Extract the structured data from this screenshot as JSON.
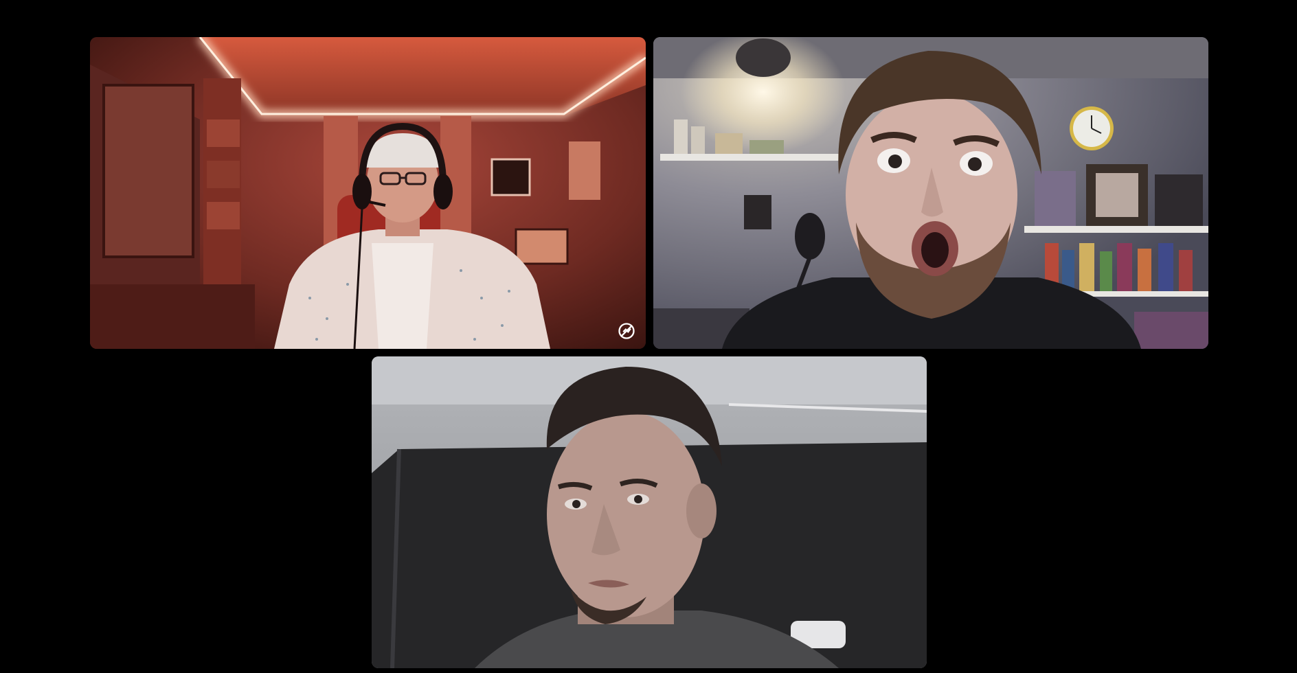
{
  "call": {
    "participants": [
      {
        "id": "participant-1",
        "video_state": "on",
        "muted": true,
        "indicator_icon": "mic-muted-icon",
        "scene_tint": "#c2412e"
      },
      {
        "id": "participant-2",
        "video_state": "on",
        "muted": false,
        "indicator_icon": "",
        "scene_tint": "#8a8aa0"
      },
      {
        "id": "participant-3",
        "video_state": "on",
        "muted": false,
        "indicator_icon": "",
        "scene_tint": "#b9b9be"
      }
    ]
  },
  "colors": {
    "background": "#000000",
    "indicator": "#ffffff"
  }
}
